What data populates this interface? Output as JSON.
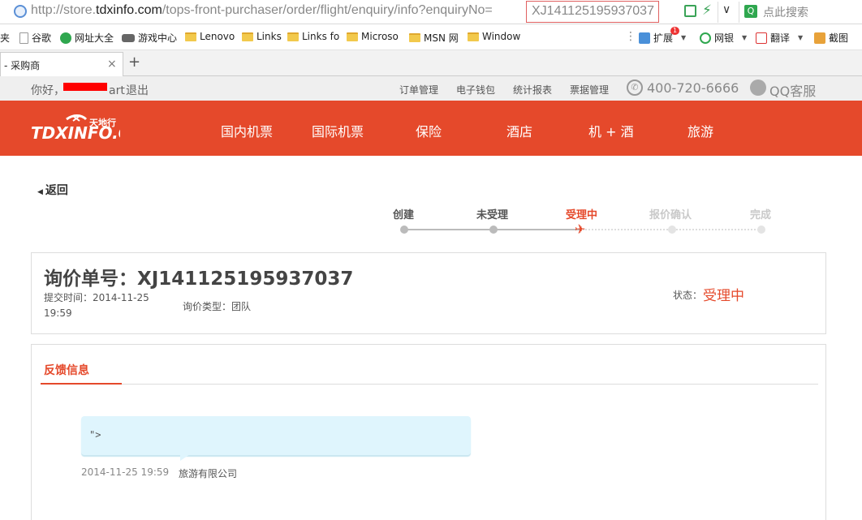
{
  "browser": {
    "url_prefix": "http://store.",
    "url_host": "tdxinfo.com",
    "url_path": "/tops-front-purchaser/order/flight/enquiry/info?enquiryNo=",
    "url_highlight": "XJ141125195937037",
    "search_placeholder": "点此搜索",
    "tab_title": "- 采购商",
    "tab_close": "×",
    "new_tab": "+",
    "bookmarks": [
      "夹",
      "谷歌",
      "网址大全",
      "游戏中心",
      "Lenovo",
      "Links",
      "Links fo",
      "Microso",
      "MSN 网",
      "Window"
    ],
    "right_tools": [
      "扩展",
      "网银",
      "翻译",
      "截图"
    ],
    "ext_badge": "1"
  },
  "topbar": {
    "welcome_prefix": "你好，",
    "welcome_suffix": "art",
    "logout": "退出",
    "links": [
      "订单管理",
      "电子钱包",
      "统计报表",
      "票据管理"
    ],
    "phone": "400-720-6666",
    "qq": "QQ客服"
  },
  "nav": {
    "logo_main": "TDXINFO.COM",
    "logo_cn": "天地行",
    "items": [
      "国内机票",
      "国际机票",
      "保险",
      "酒店",
      "机 + 酒",
      "旅游"
    ]
  },
  "back_label": "返回",
  "steps": [
    {
      "label": "创建",
      "state": "done"
    },
    {
      "label": "未受理",
      "state": "done"
    },
    {
      "label": "受理中",
      "state": "active"
    },
    {
      "label": "报价确认",
      "state": "todo"
    },
    {
      "label": "完成",
      "state": "todo"
    }
  ],
  "enquiry": {
    "title": "询价单号：XJ141125195937037",
    "submit_time": "提交时间：2014-11-25 19:59",
    "type": "询价类型：团队",
    "status_label": "状态：",
    "status_value": "受理中"
  },
  "feedback": {
    "tab_label": "反馈信息",
    "message": "\">",
    "time": "2014-11-25 19:59",
    "from": "旅游有限公司"
  },
  "colors": {
    "brand": "#e5492b",
    "bubble": "#dff5fd",
    "topbar": "#efefef"
  }
}
